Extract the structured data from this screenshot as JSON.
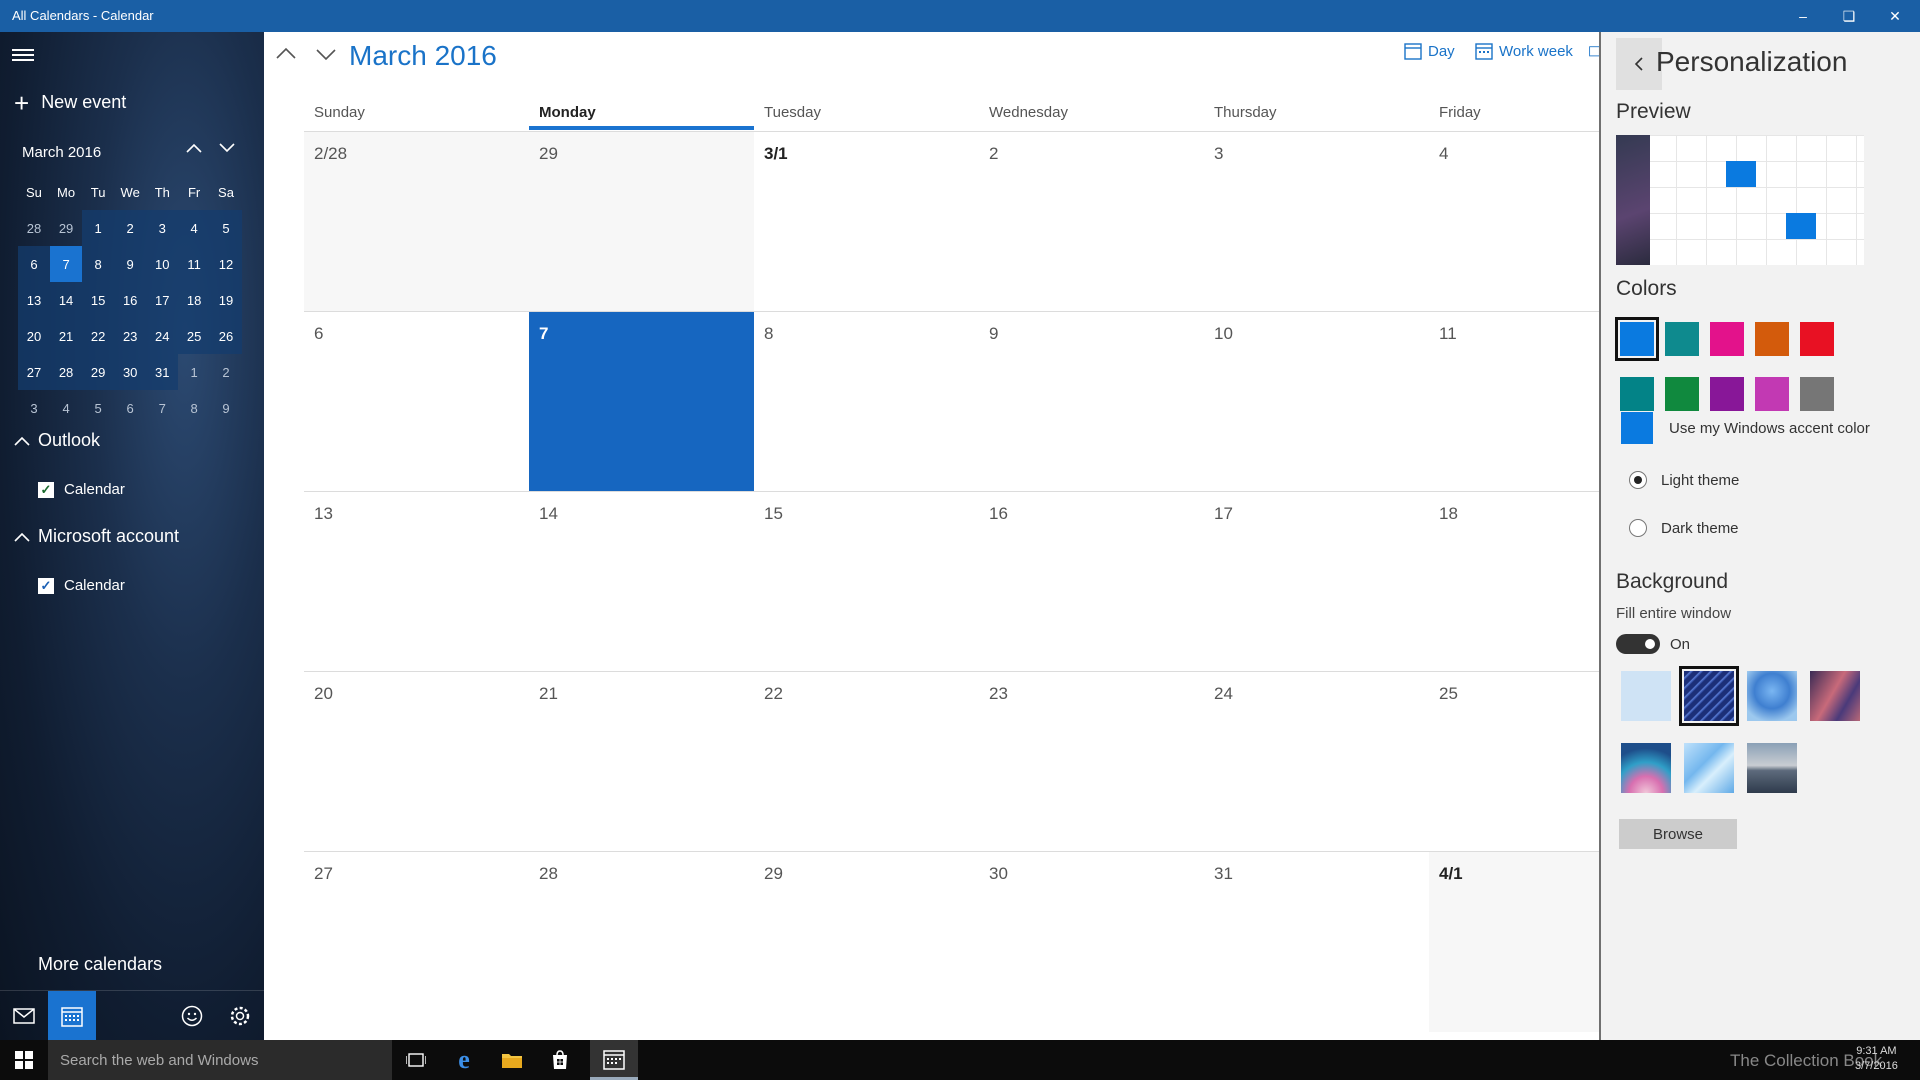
{
  "titlebar": {
    "title": "All Calendars - Calendar"
  },
  "sidebar": {
    "new_event": "New event",
    "mini_title": "March 2016",
    "weekdays": [
      "Su",
      "Mo",
      "Tu",
      "We",
      "Th",
      "Fr",
      "Sa"
    ],
    "weeks": [
      [
        "28",
        "29",
        "1",
        "2",
        "3",
        "4",
        "5"
      ],
      [
        "6",
        "7",
        "8",
        "9",
        "10",
        "11",
        "12"
      ],
      [
        "13",
        "14",
        "15",
        "16",
        "17",
        "18",
        "19"
      ],
      [
        "20",
        "21",
        "22",
        "23",
        "24",
        "25",
        "26"
      ],
      [
        "27",
        "28",
        "29",
        "30",
        "31",
        "1",
        "2"
      ],
      [
        "3",
        "4",
        "5",
        "6",
        "7",
        "8",
        "9"
      ]
    ],
    "groups": [
      {
        "label": "Outlook",
        "calendar": "Calendar",
        "check_color": "#1a6b2f"
      },
      {
        "label": "Microsoft account",
        "calendar": "Calendar",
        "check_color": "#1a5fb4"
      }
    ],
    "more_calendars": "More calendars"
  },
  "main": {
    "title": "March 2016",
    "views": {
      "day": "Day",
      "work_week": "Work week"
    },
    "day_headers": [
      "Sunday",
      "Monday",
      "Tuesday",
      "Wednesday",
      "Thursday",
      "Friday"
    ],
    "weeks": [
      [
        "2/28",
        "29",
        "3/1",
        "2",
        "3",
        "4"
      ],
      [
        "6",
        "7",
        "8",
        "9",
        "10",
        "11"
      ],
      [
        "13",
        "14",
        "15",
        "16",
        "17",
        "18"
      ],
      [
        "20",
        "21",
        "22",
        "23",
        "24",
        "25"
      ],
      [
        "27",
        "28",
        "29",
        "30",
        "31",
        "4/1"
      ]
    ]
  },
  "panel": {
    "title": "Personalization",
    "preview": "Preview",
    "colors": "Colors",
    "swatches": [
      "#0a7ae0",
      "#0e8a8e",
      "#e3128b",
      "#d35b0c",
      "#e81123",
      "#038387",
      "#10893e",
      "#881798",
      "#c239b3",
      "#767676"
    ],
    "accent_label": "Use my Windows accent color",
    "light_theme": "Light theme",
    "dark_theme": "Dark theme",
    "background": "Background",
    "fill_label": "Fill entire window",
    "toggle_state": "On",
    "browse": "Browse"
  },
  "taskbar": {
    "search": "Search the web and Windows",
    "watermark": "The Collection Book",
    "time": "9:31 AM",
    "date": "3/7/2016"
  },
  "colors": {
    "accent": "#1a73d0",
    "titlebar": "#1a5fa5"
  }
}
